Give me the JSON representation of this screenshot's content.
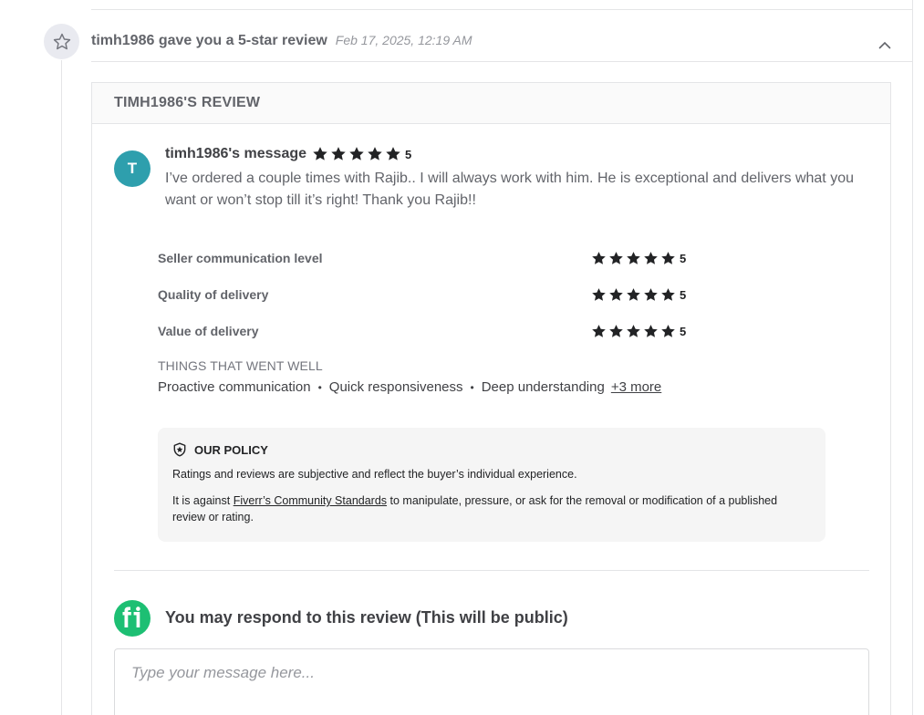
{
  "event": {
    "title": "timh1986 gave you a 5-star review",
    "timestamp": "Feb 17, 2025, 12:19 AM",
    "icon": "star-outline-icon",
    "collapse_icon": "chevron-up-icon"
  },
  "review": {
    "header": "TIMH1986'S REVIEW",
    "avatar_letter": "T",
    "avatar_color": "#2e9fad",
    "author_label": "timh1986's message",
    "overall_rating": 5,
    "overall_rating_label": "5",
    "message": "I’ve ordered a couple times with Rajib.. I will always work with him. He is exceptional and delivers what you want or won’t stop till it’s right! Thank you Rajib!!",
    "ratings": [
      {
        "label": "Seller communication level",
        "value": 5,
        "value_label": "5"
      },
      {
        "label": "Quality of delivery",
        "value": 5,
        "value_label": "5"
      },
      {
        "label": "Value of delivery",
        "value": 5,
        "value_label": "5"
      }
    ],
    "went_well_title": "THINGS THAT WENT WELL",
    "went_well_tags": [
      "Proactive communication",
      "Quick responsiveness",
      "Deep understanding"
    ],
    "tag_separator": "•",
    "more_label": "+3 more"
  },
  "policy": {
    "icon": "shield-star-icon",
    "title": "OUR POLICY",
    "paragraph1": "Ratings and reviews are subjective and reflect the buyer’s individual experience.",
    "paragraph2_prefix": "It is against ",
    "paragraph2_link": "Fiverr’s Community Standards",
    "paragraph2_suffix": " to manipulate, pressure, or ask for the removal or modification of a published review or rating."
  },
  "respond": {
    "logo_icon": "fiverr-logo-icon",
    "logo_color": "#1dbf73",
    "title": "You may respond to this review (This will be public)",
    "placeholder": "Type your message here..."
  },
  "colors": {
    "star": "#222325",
    "text_primary": "#404145",
    "text_secondary": "#62646a",
    "border": "#e4e5e7"
  }
}
